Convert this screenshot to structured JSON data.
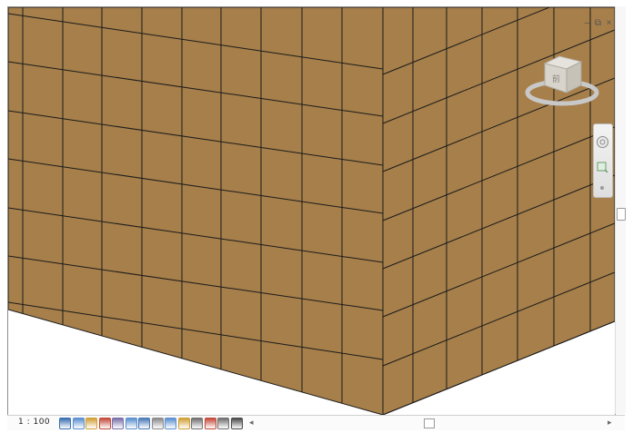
{
  "view": {
    "material_color": "#a67f4a",
    "grid_line_color": "#1b1b1b",
    "background_color": "#ffffff"
  },
  "window_controls": {
    "minimize": "–",
    "restore": "⧉",
    "close": "×"
  },
  "viewcube": {
    "face_label": "前"
  },
  "status_bar": {
    "scale_text": "1 : 100",
    "icons": [
      "detail-level-icon",
      "visual-style-icon",
      "sun-path-icon",
      "shadows-icon",
      "rendering-icon",
      "crop-view-icon",
      "show-crop-icon",
      "unlock-3d-icon",
      "temporary-hide-icon",
      "reveal-hidden-icon",
      "analysis-display-icon",
      "highlight-displacement-icon",
      "hide-analytical-icon",
      "constraints-icon"
    ]
  }
}
